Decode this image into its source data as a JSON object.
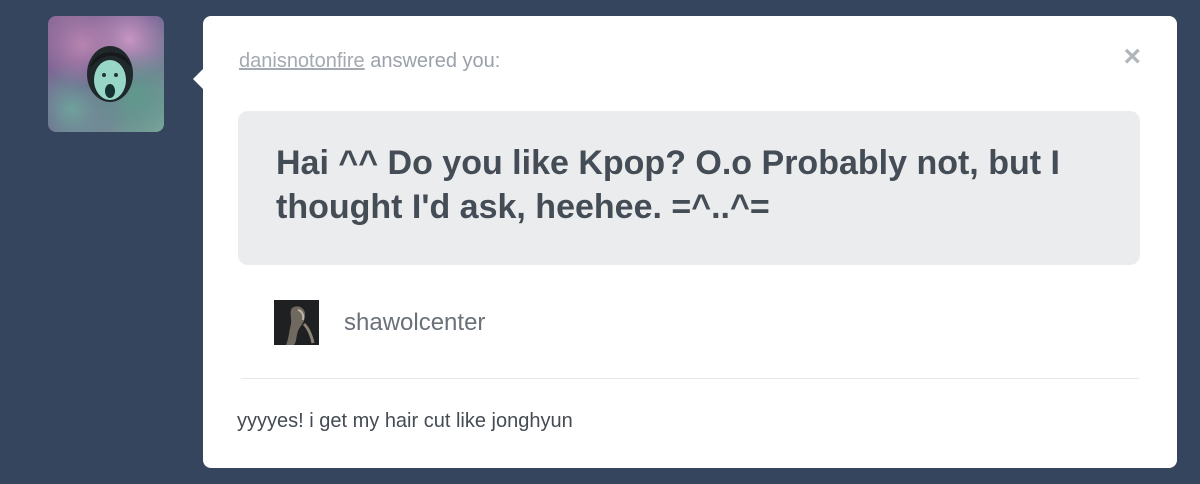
{
  "profile": {
    "avatar_icon": "user-avatar-icon"
  },
  "post": {
    "answerer_name": "danisnotonfire",
    "answered_label": "answered you:",
    "close_icon": "close-icon",
    "close_symbol": "×",
    "question_text": "Hai ^^ Do you like Kpop? O.o Probably not, but I thought I'd ask, heehee. =^..^=",
    "asker_name": "shawolcenter",
    "answer_text": "yyyyes! i get my hair cut like jonghyun"
  },
  "colors": {
    "background": "#34455d",
    "card": "#ffffff",
    "question_box": "#ebecee",
    "text_dark": "#444c55",
    "text_muted": "#9aa1a9"
  }
}
